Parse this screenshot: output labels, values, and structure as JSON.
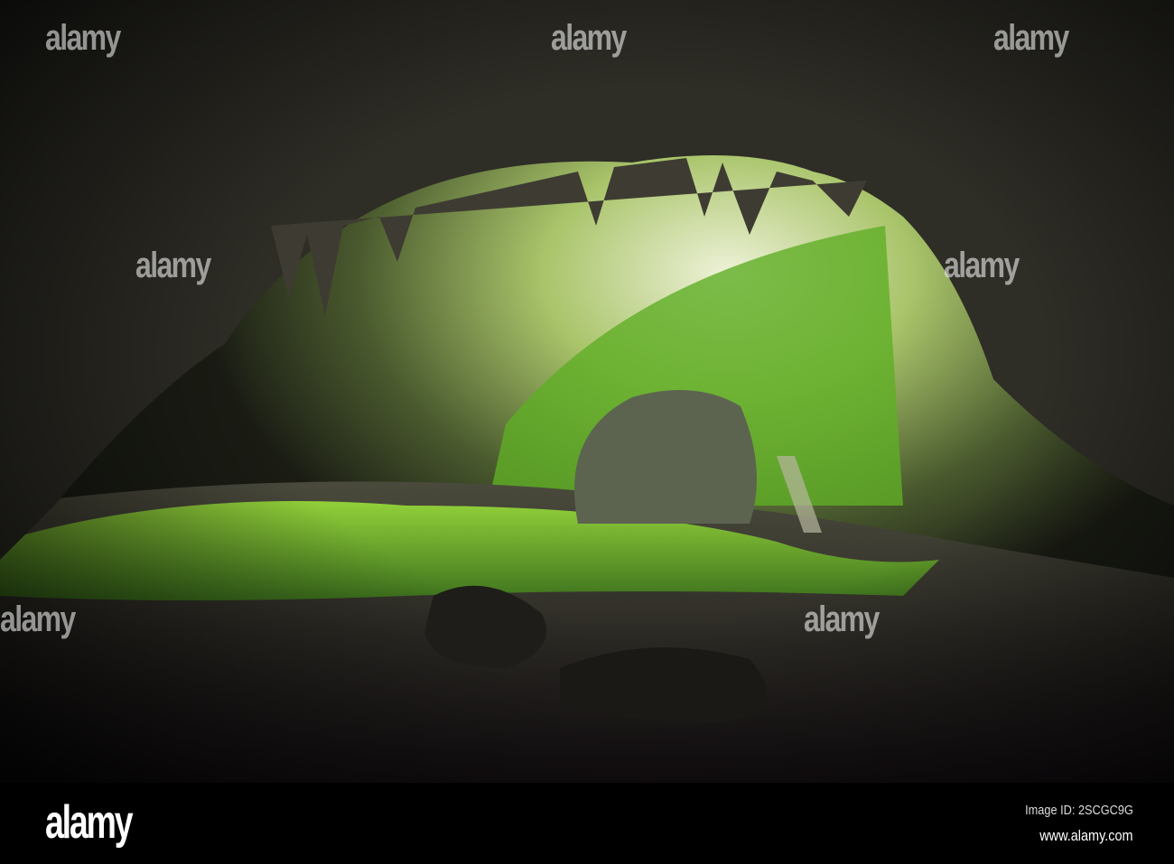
{
  "photo": {
    "subject": "cave",
    "watermark_text": "alamy"
  },
  "footer": {
    "logo": "alamy",
    "image_id": "Image ID: 2SCGC9G",
    "url": "www.alamy.com"
  },
  "colors": {
    "foliage": "#7cc82a",
    "rock": "#3b3a33",
    "light": "#e8e6c8"
  }
}
